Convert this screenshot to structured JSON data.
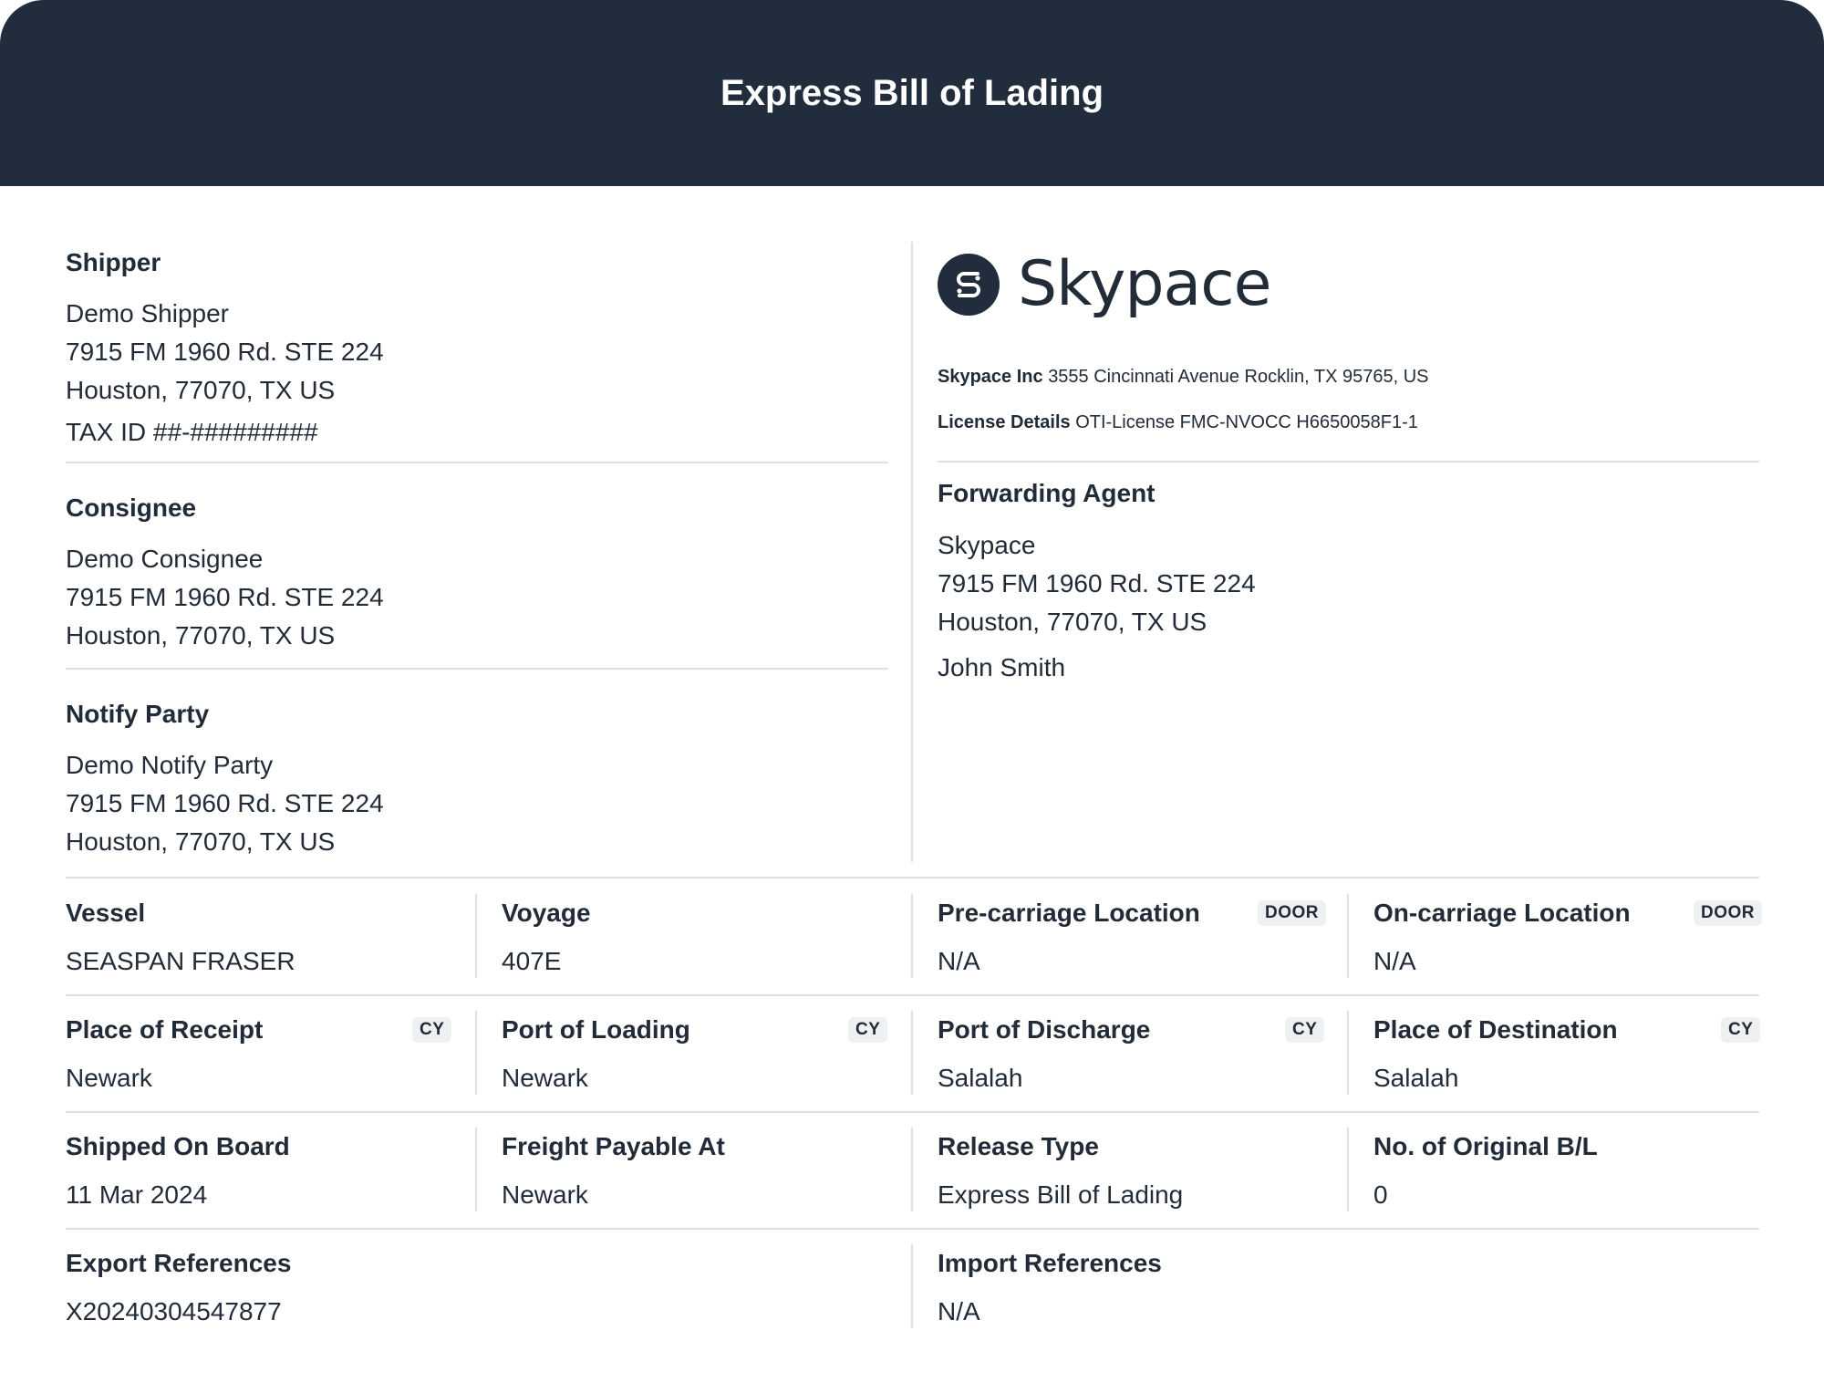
{
  "header": {
    "title": "Express Bill of Lading"
  },
  "shipper": {
    "title": "Shipper",
    "name": "Demo Shipper",
    "address1": "7915 FM 1960 Rd. STE 224",
    "address2": "Houston, 77070, TX US",
    "tax_id": "TAX ID ##-#########"
  },
  "consignee": {
    "title": "Consignee",
    "name": "Demo Consignee",
    "address1": "7915 FM 1960 Rd. STE 224",
    "address2": "Houston, 77070, TX US"
  },
  "notify_party": {
    "title": "Notify Party",
    "name": "Demo Notify Party",
    "address1": "7915 FM 1960 Rd. STE 224",
    "address2": "Houston, 77070, TX US"
  },
  "company": {
    "logo_text": "Skypace",
    "name_label": "Skypace Inc",
    "address": "3555 Cincinnati Avenue Rocklin, TX 95765, US",
    "license_label": "License Details",
    "license": "OTI-License FMC-NVOCC H6650058F1-1"
  },
  "forwarding_agent": {
    "title": "Forwarding Agent",
    "name": "Skypace",
    "address1": "7915 FM 1960 Rd. STE 224",
    "address2": "Houston, 77070, TX US",
    "contact": "John Smith"
  },
  "grid": {
    "vessel": {
      "label": "Vessel",
      "value": "SEASPAN FRASER"
    },
    "voyage": {
      "label": "Voyage",
      "value": "407E"
    },
    "pre_carriage": {
      "label": "Pre-carriage Location",
      "badge": "DOOR",
      "value": "N/A"
    },
    "on_carriage": {
      "label": "On-carriage Location",
      "badge": "DOOR",
      "value": "N/A"
    },
    "place_of_receipt": {
      "label": "Place of Receipt",
      "badge": "CY",
      "value": "Newark"
    },
    "port_of_loading": {
      "label": "Port of Loading",
      "badge": "CY",
      "value": "Newark"
    },
    "port_of_discharge": {
      "label": "Port of Discharge",
      "badge": "CY",
      "value": "Salalah"
    },
    "place_of_destination": {
      "label": "Place of Destination",
      "badge": "CY",
      "value": "Salalah"
    },
    "shipped_on_board": {
      "label": "Shipped On Board",
      "value": "11 Mar 2024"
    },
    "freight_payable_at": {
      "label": "Freight Payable At",
      "value": "Newark"
    },
    "release_type": {
      "label": "Release Type",
      "value": "Express Bill of Lading"
    },
    "original_bl": {
      "label": "No. of Original B/L",
      "value": "0"
    },
    "export_references": {
      "label": "Export References",
      "value": "X20240304547877"
    },
    "import_references": {
      "label": "Import References",
      "value": "N/A"
    }
  },
  "colors": {
    "header_bg": "#212c3c",
    "text": "#222b38",
    "divider": "#dde0e4",
    "badge_bg": "#eef0f2"
  }
}
